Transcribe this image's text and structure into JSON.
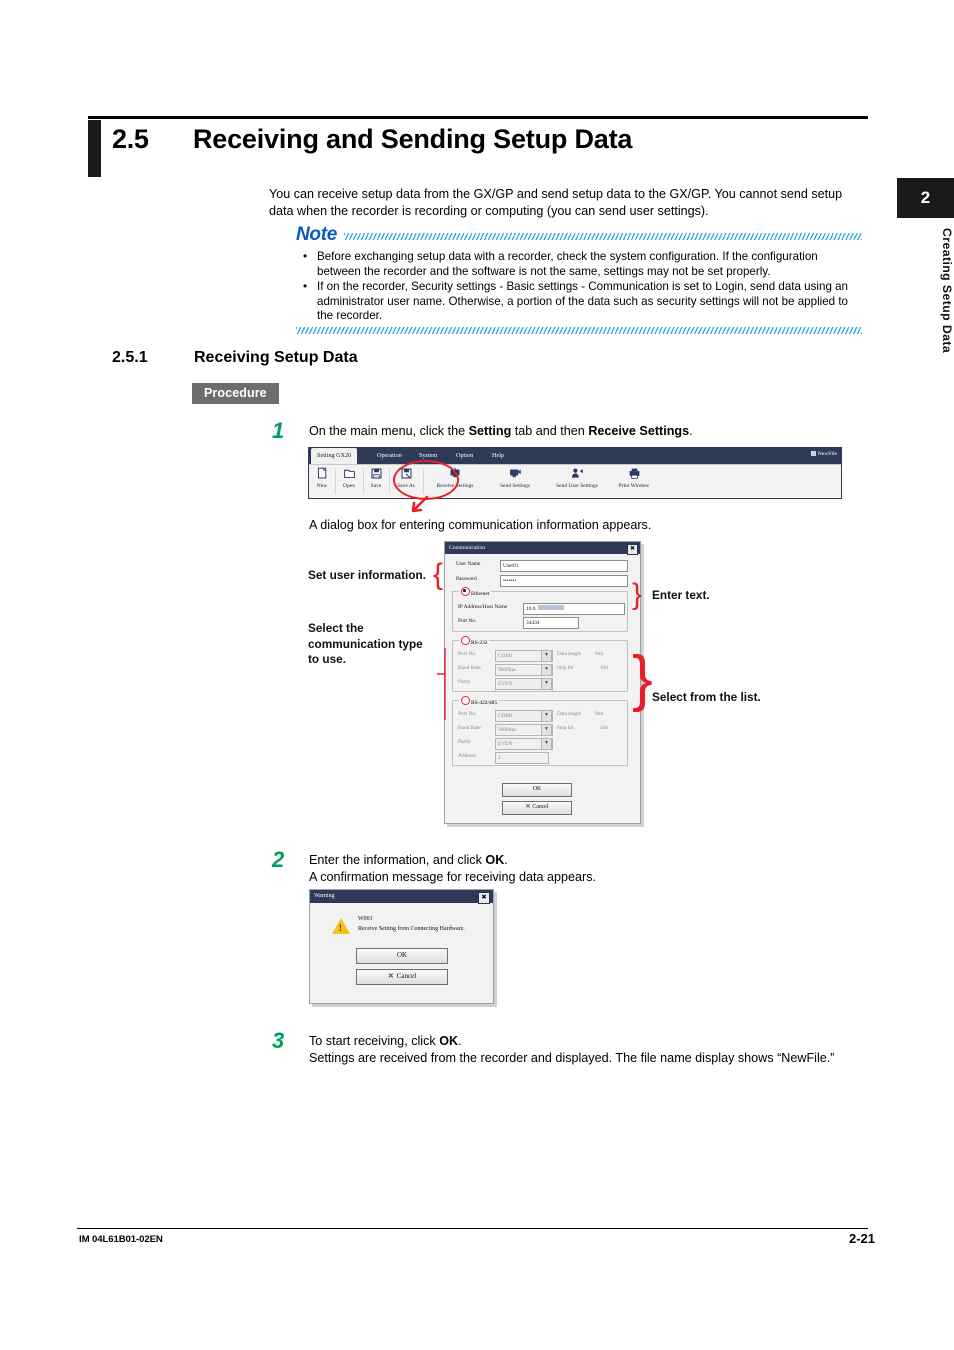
{
  "section": {
    "number": "2.5",
    "title": "Receiving and Sending Setup Data",
    "intro": "You can receive setup data from the GX/GP and send setup data to the GX/GP. You cannot send setup data when the recorder is recording or computing (you can send user settings)."
  },
  "note": {
    "label": "Note",
    "items": [
      "Before exchanging setup data with a recorder, check the system configuration. If the configuration between the recorder and the software is not the same, settings may not be set properly.",
      "If on the recorder, Security settings - Basic settings - Communication is set to Login, send data using an administrator user name. Otherwise, a portion of the data such as security settings will not be applied to the recorder."
    ],
    "bullet": "•"
  },
  "subsection": {
    "number": "2.5.1",
    "title": "Receiving Setup Data",
    "procedure_badge": "Procedure"
  },
  "steps": [
    {
      "number": "1",
      "line1_pre": "On the main menu, click the ",
      "line1_b1": "Setting",
      "line1_mid": " tab and then ",
      "line1_b2": "Receive Settings",
      "line1_post": "."
    },
    {
      "number": "2",
      "line1_pre": "Enter the information, and click ",
      "line1_b1": "OK",
      "line1_post": ".",
      "line2": "A confirmation message for receiving data appears."
    },
    {
      "number": "3",
      "line1_pre": "To start receiving, click ",
      "line1_b1": "OK",
      "line1_post": ".",
      "line2": "Settings are received from the recorder and displayed. The file name display shows “NewFile.”"
    }
  ],
  "caption_dialog": "A dialog box for entering communication information appears.",
  "app_window": {
    "tabs": [
      {
        "label": "Setting GX20",
        "active": true
      },
      {
        "label": "Operation",
        "active": false
      },
      {
        "label": "System",
        "active": false
      },
      {
        "label": "Option",
        "active": false
      },
      {
        "label": "Help",
        "active": false
      }
    ],
    "file_name": "NewFile",
    "toolbar": [
      {
        "label": "New",
        "icon": "new-document-icon",
        "glyph": "☐"
      },
      {
        "label": "Open",
        "icon": "open-folder-icon",
        "glyph": "☐"
      },
      {
        "label": "Save",
        "icon": "save-disk-icon",
        "glyph": "☐"
      },
      {
        "label": "Save As",
        "icon": "save-as-disk-icon",
        "glyph": "☐"
      },
      {
        "label": "Receive Settings",
        "icon": "receive-settings-icon",
        "glyph": "☐"
      },
      {
        "label": "Send Settings",
        "icon": "send-settings-icon",
        "glyph": "☐"
      },
      {
        "label": "Send User Settings",
        "icon": "send-user-settings-icon",
        "glyph": "☐"
      },
      {
        "label": "Print Window",
        "icon": "print-window-icon",
        "glyph": "☐"
      }
    ],
    "highlight": "Receive Settings"
  },
  "communication_dialog": {
    "title": "Communication",
    "close_label": "✖",
    "user_name_label": "User Name",
    "user_name_value": "User01",
    "password_label": "Password",
    "password_value": "•••••••",
    "ethernet": {
      "group_label": "Ethernet",
      "selected": true,
      "ip_label": "IP Address/Host Name",
      "ip_value": "10.0.",
      "port_label": "Port No.",
      "port_value": "34434"
    },
    "rs232": {
      "group_label": "RS-232",
      "selected": false,
      "port_label": "Port No.",
      "port_value": "COM1",
      "baud_label": "Baud Rate",
      "baud_value": "9600bps",
      "parity_label": "Parity",
      "parity_value": "EVEN",
      "data_length_label": "Data length",
      "data_length_value": "8bit",
      "stop_bit_label": "Stop bit",
      "stop_bit_value": "1bit"
    },
    "rs422": {
      "group_label": "RS-422/485",
      "selected": false,
      "port_label": "Port No.",
      "port_value": "COM1",
      "baud_label": "Baud Rate",
      "baud_value": "9600bps",
      "parity_label": "Parity",
      "parity_value": "EVEN",
      "data_length_label": "Data length",
      "data_length_value": "8bit",
      "stop_bit_label": "Stop bit",
      "stop_bit_value": "1bit",
      "address_label": "Address",
      "address_value": "1"
    },
    "ok_label": "OK",
    "cancel_label": "Cancel",
    "dropdown_glyph": "▼"
  },
  "callouts": {
    "set_user_information": "Set user information.",
    "select_comm_type_l1": "Select the",
    "select_comm_type_l2": "communication type",
    "select_comm_type_l3": "to use.",
    "enter_text": "Enter text.",
    "select_from_list": "Select from the list."
  },
  "warning_dialog": {
    "title": "Warning",
    "close_label": "✖",
    "code": "W001",
    "message": "Receive Setting from Connecting Hardware.",
    "ok_label": "OK",
    "cancel_label": "Cancel"
  },
  "side_tab": {
    "chapter": "2",
    "label": "Creating Setup Data"
  },
  "footer": {
    "doc_id": "IM 04L61B01-02EN",
    "page": "2-21"
  },
  "colors": {
    "note_blue": "#0d57c4",
    "hatch_blue": "#29a9e8",
    "step_green": "#00a05a",
    "highlight_red": "#e8202a",
    "app_navy": "#2e3a57",
    "badge_gray": "#6d6d6d"
  }
}
